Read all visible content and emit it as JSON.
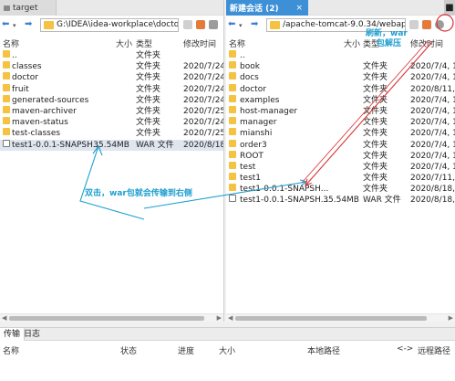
{
  "left": {
    "tab_title": "target",
    "path": "G:\\IDEA\\idea-workplace\\doctor",
    "headers": {
      "name": "名称",
      "size": "大小",
      "type": "类型",
      "modified": "修改时间"
    },
    "rows": [
      {
        "name": "..",
        "size": "",
        "type": "文件夹",
        "modified": "",
        "icon": "up"
      },
      {
        "name": "classes",
        "size": "",
        "type": "文件夹",
        "modified": "2020/7/24, 9",
        "icon": "folder"
      },
      {
        "name": "doctor",
        "size": "",
        "type": "文件夹",
        "modified": "2020/7/24, 9",
        "icon": "folder"
      },
      {
        "name": "fruit",
        "size": "",
        "type": "文件夹",
        "modified": "2020/7/24, 9",
        "icon": "folder"
      },
      {
        "name": "generated-sources",
        "size": "",
        "type": "文件夹",
        "modified": "2020/7/24, 9",
        "icon": "folder"
      },
      {
        "name": "maven-archiver",
        "size": "",
        "type": "文件夹",
        "modified": "2020/7/25,",
        "icon": "folder"
      },
      {
        "name": "maven-status",
        "size": "",
        "type": "文件夹",
        "modified": "2020/7/24, 9",
        "icon": "folder"
      },
      {
        "name": "test-classes",
        "size": "",
        "type": "文件夹",
        "modified": "2020/7/25,",
        "icon": "folder"
      },
      {
        "name": "test1-0.0.1-SNAPSH...",
        "size": "35.54MB",
        "type": "WAR 文件",
        "modified": "2020/8/18,",
        "icon": "file",
        "selected": true
      }
    ]
  },
  "right": {
    "tab_title": "新建会话 (2)",
    "tab_close": "×",
    "path": "/apache-tomcat-9.0.34/webapps",
    "headers": {
      "name": "名称",
      "size": "大小",
      "type": "类型",
      "modified": "修改时间"
    },
    "rows": [
      {
        "name": "..",
        "size": "",
        "type": "",
        "modified": "",
        "icon": "up"
      },
      {
        "name": "book",
        "size": "",
        "type": "文件夹",
        "modified": "2020/7/4, 13",
        "icon": "folder"
      },
      {
        "name": "docs",
        "size": "",
        "type": "文件夹",
        "modified": "2020/7/4, 13",
        "icon": "folder"
      },
      {
        "name": "doctor",
        "size": "",
        "type": "文件夹",
        "modified": "2020/8/11, 0",
        "icon": "folder"
      },
      {
        "name": "examples",
        "size": "",
        "type": "文件夹",
        "modified": "2020/7/4, 13",
        "icon": "folder"
      },
      {
        "name": "host-manager",
        "size": "",
        "type": "文件夹",
        "modified": "2020/7/4, 13",
        "icon": "folder"
      },
      {
        "name": "manager",
        "size": "",
        "type": "文件夹",
        "modified": "2020/7/4, 13",
        "icon": "folder"
      },
      {
        "name": "mianshi",
        "size": "",
        "type": "文件夹",
        "modified": "2020/7/4, 13",
        "icon": "folder"
      },
      {
        "name": "order3",
        "size": "",
        "type": "文件夹",
        "modified": "2020/7/4, 13",
        "icon": "folder"
      },
      {
        "name": "ROOT",
        "size": "",
        "type": "文件夹",
        "modified": "2020/7/4, 13",
        "icon": "folder"
      },
      {
        "name": "test",
        "size": "",
        "type": "文件夹",
        "modified": "2020/7/4, 13",
        "icon": "folder"
      },
      {
        "name": "test1",
        "size": "",
        "type": "文件夹",
        "modified": "2020/7/11, 0",
        "icon": "folder"
      },
      {
        "name": "test1-0.0.1-SNAPSH...",
        "size": "",
        "type": "文件夹",
        "modified": "2020/8/18, 1",
        "icon": "folder"
      },
      {
        "name": "test1-0.0.1-SNAPSH...",
        "size": "35.54MB",
        "type": "WAR 文件",
        "modified": "2020/8/18, 1",
        "icon": "file"
      }
    ]
  },
  "bottom": {
    "tabs": [
      "传输",
      "日志"
    ],
    "headers": {
      "name": "名称",
      "status": "状态",
      "progress": "进度",
      "size": "大小",
      "local_path": "本地路径",
      "arrow": "<->",
      "remote_path": "远程路径"
    }
  },
  "annotations": {
    "double_click": "双击，war包就会传输到右侧",
    "refresh_line1": "刷新，war",
    "refresh_line2": "包解压"
  },
  "colors": {
    "accent": "#3d8fd6",
    "annotation_blue": "#1e9fd0",
    "annotation_red": "#d93030",
    "folder": "#f5c242"
  }
}
